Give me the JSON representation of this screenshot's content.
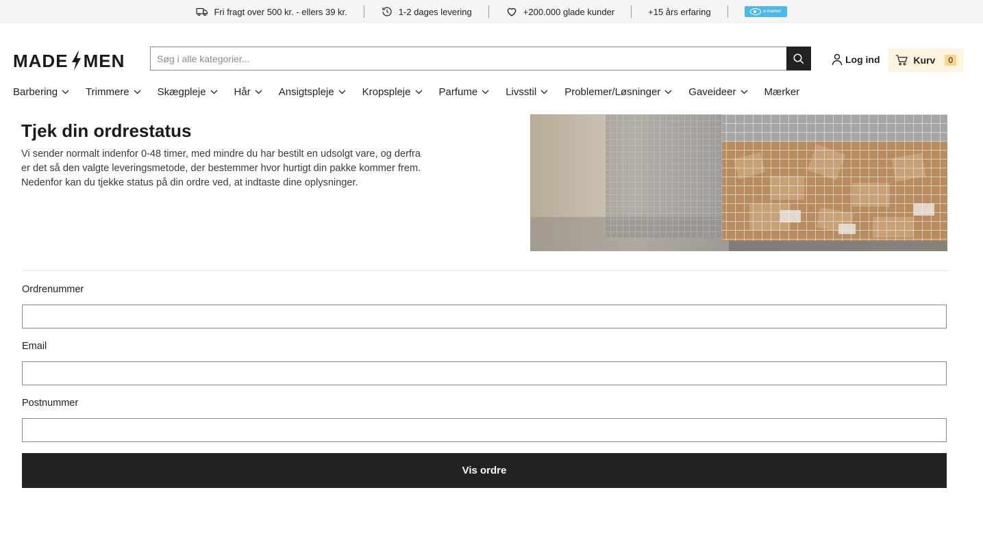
{
  "usp": [
    {
      "icon": "truck-icon",
      "text": "Fri fragt over 500 kr. - ellers 39 kr."
    },
    {
      "icon": "clock-icon",
      "text": "1-2 dages levering"
    },
    {
      "icon": "heart-icon",
      "text": "+200.000 glade kunder"
    },
    {
      "icon": "",
      "text": "+15 års erfaring"
    }
  ],
  "emaerket": {
    "text": "e-mærket"
  },
  "header": {
    "logo_left": "MADE",
    "logo_right": "MEN",
    "search_placeholder": "Søg i alle kategorier...",
    "login_label": "Log ind",
    "cart_label": "Kurv",
    "cart_count": "0"
  },
  "nav": [
    {
      "label": "Barbering",
      "dropdown": true
    },
    {
      "label": "Trimmere",
      "dropdown": true
    },
    {
      "label": "Skægpleje",
      "dropdown": true
    },
    {
      "label": "Hår",
      "dropdown": true
    },
    {
      "label": "Ansigtspleje",
      "dropdown": true
    },
    {
      "label": "Kropspleje",
      "dropdown": true
    },
    {
      "label": "Parfume",
      "dropdown": true
    },
    {
      "label": "Livsstil",
      "dropdown": true
    },
    {
      "label": "Problemer/Løsninger",
      "dropdown": true
    },
    {
      "label": "Gaveideer",
      "dropdown": true
    },
    {
      "label": "Mærker",
      "dropdown": false
    }
  ],
  "page": {
    "title": "Tjek din ordrestatus",
    "intro": "Vi sender normalt indenfor 0-48 timer, med mindre du har bestilt en udsolgt vare, og derfra er det så den valgte leveringsmetode, der bestemmer hvor hurtigt din pakke kommer frem. Nedenfor kan du tjekke status på din ordre ved, at indtaste dine oplysninger."
  },
  "form": {
    "order_label": "Ordrenummer",
    "order_value": "",
    "email_label": "Email",
    "email_value": "",
    "zip_label": "Postnummer",
    "zip_value": "",
    "submit_label": "Vis ordre"
  },
  "colors": {
    "dark": "#222222",
    "cart_bg": "#fdf3de",
    "cart_badge": "#f9d48c",
    "emaerket": "#4fb8e6"
  }
}
